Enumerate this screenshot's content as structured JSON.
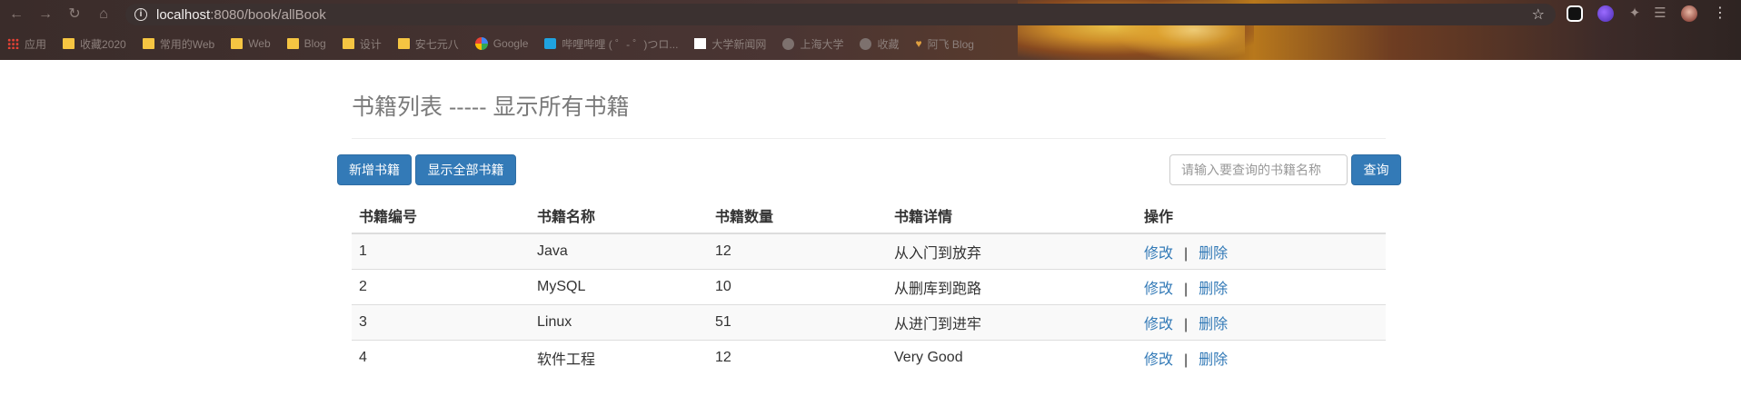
{
  "browser": {
    "url_host": "localhost",
    "url_path": ":8080/book/allBook",
    "bookmarks": [
      {
        "label": "应用",
        "icon": "apps-icon"
      },
      {
        "label": "收藏2020",
        "icon": "folder-icon"
      },
      {
        "label": "常用的Web",
        "icon": "folder-icon"
      },
      {
        "label": "Web",
        "icon": "folder-icon"
      },
      {
        "label": "Blog",
        "icon": "folder-icon"
      },
      {
        "label": "设计",
        "icon": "folder-icon"
      },
      {
        "label": "安七元八",
        "icon": "folder-icon"
      },
      {
        "label": "Google",
        "icon": "google-icon"
      },
      {
        "label": "哔哩哔哩 ( ゜- ゜)つロ...",
        "icon": "bilibili-icon"
      },
      {
        "label": "大学新闻网",
        "icon": "page-icon"
      },
      {
        "label": "上海大学",
        "icon": "globe-icon"
      },
      {
        "label": "收藏",
        "icon": "globe-icon"
      },
      {
        "label": "阿飞 Blog",
        "icon": "heart-icon"
      }
    ]
  },
  "page": {
    "title": "书籍列表 ----- 显示所有书籍",
    "add_button": "新增书籍",
    "show_all_button": "显示全部书籍",
    "search_placeholder": "请输入要查询的书籍名称",
    "search_button": "查询"
  },
  "table": {
    "headers": [
      "书籍编号",
      "书籍名称",
      "书籍数量",
      "书籍详情",
      "操作"
    ],
    "edit_label": "修改",
    "separator": "|",
    "delete_label": "删除",
    "rows": [
      {
        "id": "1",
        "name": "Java",
        "count": "12",
        "detail": "从入门到放弃"
      },
      {
        "id": "2",
        "name": "MySQL",
        "count": "10",
        "detail": "从删库到跑路"
      },
      {
        "id": "3",
        "name": "Linux",
        "count": "51",
        "detail": "从进门到进牢"
      },
      {
        "id": "4",
        "name": "软件工程",
        "count": "12",
        "detail": "Very Good"
      }
    ]
  }
}
